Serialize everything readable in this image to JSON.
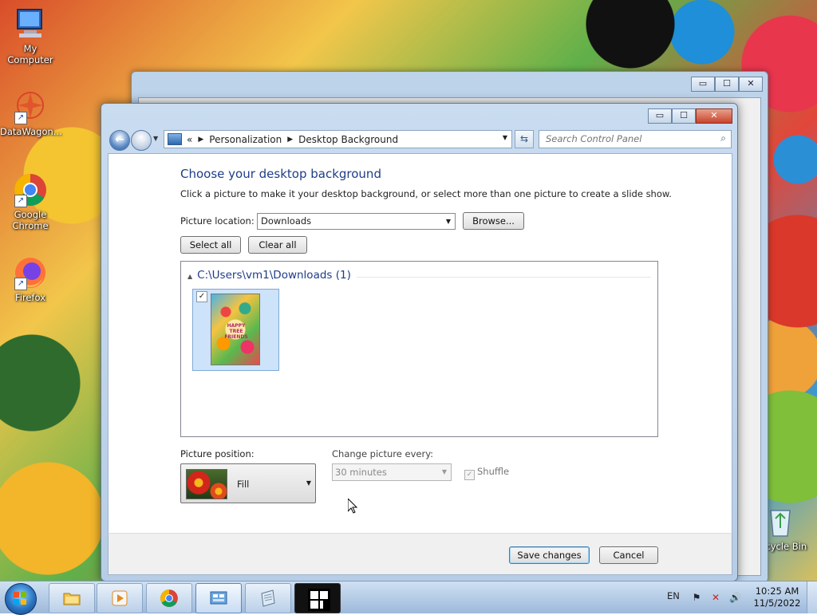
{
  "desktop": {
    "icons": [
      {
        "label": "My Computer"
      },
      {
        "label": "DataWagon..."
      },
      {
        "label": "Google Chrome"
      },
      {
        "label": "Firefox"
      },
      {
        "label": "Recycle Bin"
      }
    ]
  },
  "window": {
    "caption_buttons": {
      "minimize": "▭",
      "maximize": "☐",
      "close": "✕"
    },
    "breadcrumb": {
      "overflow": "«",
      "items": [
        "Personalization",
        "Desktop Background"
      ]
    },
    "search": {
      "placeholder": "Search Control Panel"
    },
    "title": "Choose your desktop background",
    "description": "Click a picture to make it your desktop background, or select more than one picture to create a slide show.",
    "picture_location": {
      "label": "Picture location:",
      "value": "Downloads",
      "browse": "Browse..."
    },
    "select_all": "Select all",
    "clear_all": "Clear all",
    "gallery": {
      "group_header": "C:\\Users\\vm1\\Downloads (1)",
      "items": [
        {
          "checked": true,
          "text": "HAPPY TREE FRIENDS"
        }
      ]
    },
    "picture_position": {
      "label": "Picture position:",
      "value": "Fill"
    },
    "change_picture": {
      "label": "Change picture every:",
      "value": "30 minutes",
      "enabled": false
    },
    "shuffle": {
      "label": "Shuffle",
      "checked": true,
      "enabled": false
    },
    "save_button": "Save changes",
    "cancel_button": "Cancel"
  },
  "taskbar": {
    "items": [
      "windows-explorer",
      "media-player",
      "google-chrome",
      "control-panel",
      "notepad",
      "omdi-app"
    ],
    "language": "EN",
    "time": "10:25 AM",
    "date": "11/5/2022"
  },
  "colors": {
    "accent": "#1e3c88",
    "selection": "#cce3f9",
    "default_button_border": "#3c7fb1"
  }
}
